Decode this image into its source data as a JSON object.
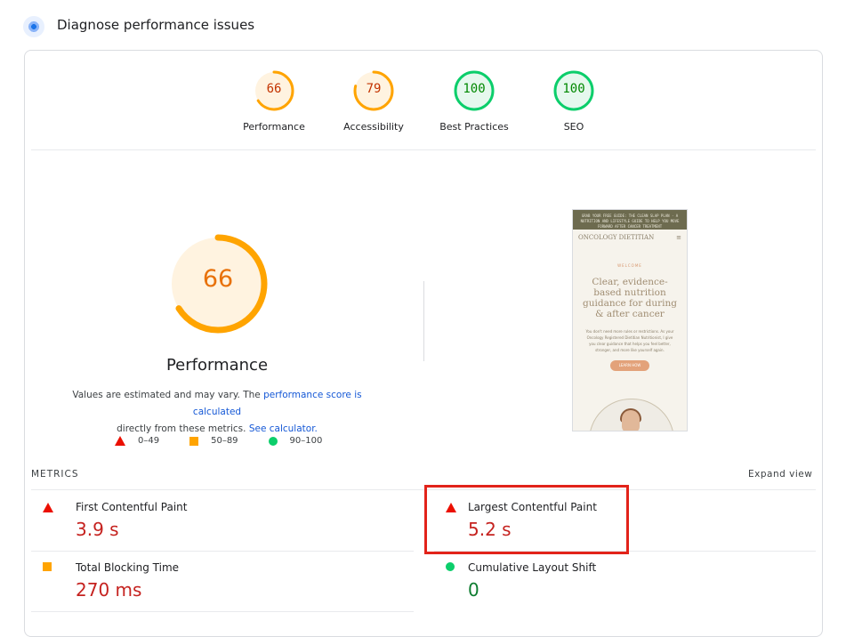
{
  "header": {
    "title": "Diagnose performance issues",
    "icon": "lighthouse-icon"
  },
  "gauges": [
    {
      "label": "Performance",
      "score": "66",
      "value": 66,
      "color": "#ffa400",
      "text_color": "#c33300"
    },
    {
      "label": "Accessibility",
      "score": "79",
      "value": 79,
      "color": "#ffa400",
      "text_color": "#c33300"
    },
    {
      "label": "Best Practices",
      "score": "100",
      "value": 100,
      "color": "#0cce6b",
      "text_color": "#008800"
    },
    {
      "label": "SEO",
      "score": "100",
      "value": 100,
      "color": "#0cce6b",
      "text_color": "#008800"
    }
  ],
  "main_gauge": {
    "score": "66",
    "value": 66,
    "title": "Performance",
    "color": "#ffa400"
  },
  "note": {
    "text1": "Values are estimated and may vary. The ",
    "link1": "performance score is calculated",
    "text2": " directly from these metrics. ",
    "link2": "See calculator."
  },
  "legend": [
    {
      "shape": "triangle",
      "range": "0–49",
      "color": "#eb0f00"
    },
    {
      "shape": "square",
      "range": "50–89",
      "color": "#ffa400"
    },
    {
      "shape": "circle",
      "range": "90–100",
      "color": "#0cce6b"
    }
  ],
  "screenshot": {
    "banner": "GRAB YOUR FREE GUIDE: THE CLEAN SLAP PLAN · A NUTRITION AND LIFESTYLE GUIDE TO HELP YOU MOVE FORWARD AFTER CANCER TREATMENT",
    "brand": "ONCOLOGY DIETITIAN",
    "welcome": "WELCOME",
    "heading": "Clear, evidence-based nutrition guidance for during & after cancer",
    "paragraph": "You don't need more rules or restrictions. As your Oncology Registered Dietitian Nutritionist, I give you clear guidance that helps you feel better, stronger, and more like yourself again.",
    "button": "LEARN HOW"
  },
  "metrics": {
    "title": "METRICS",
    "expand": "Expand view",
    "items": [
      {
        "label": "First Contentful Paint",
        "value": "3.9 s",
        "status": "fail"
      },
      {
        "label": "Largest Contentful Paint",
        "value": "5.2 s",
        "status": "fail"
      },
      {
        "label": "Total Blocking Time",
        "value": "270 ms",
        "status": "average"
      },
      {
        "label": "Cumulative Layout Shift",
        "value": "0",
        "status": "pass"
      }
    ]
  }
}
